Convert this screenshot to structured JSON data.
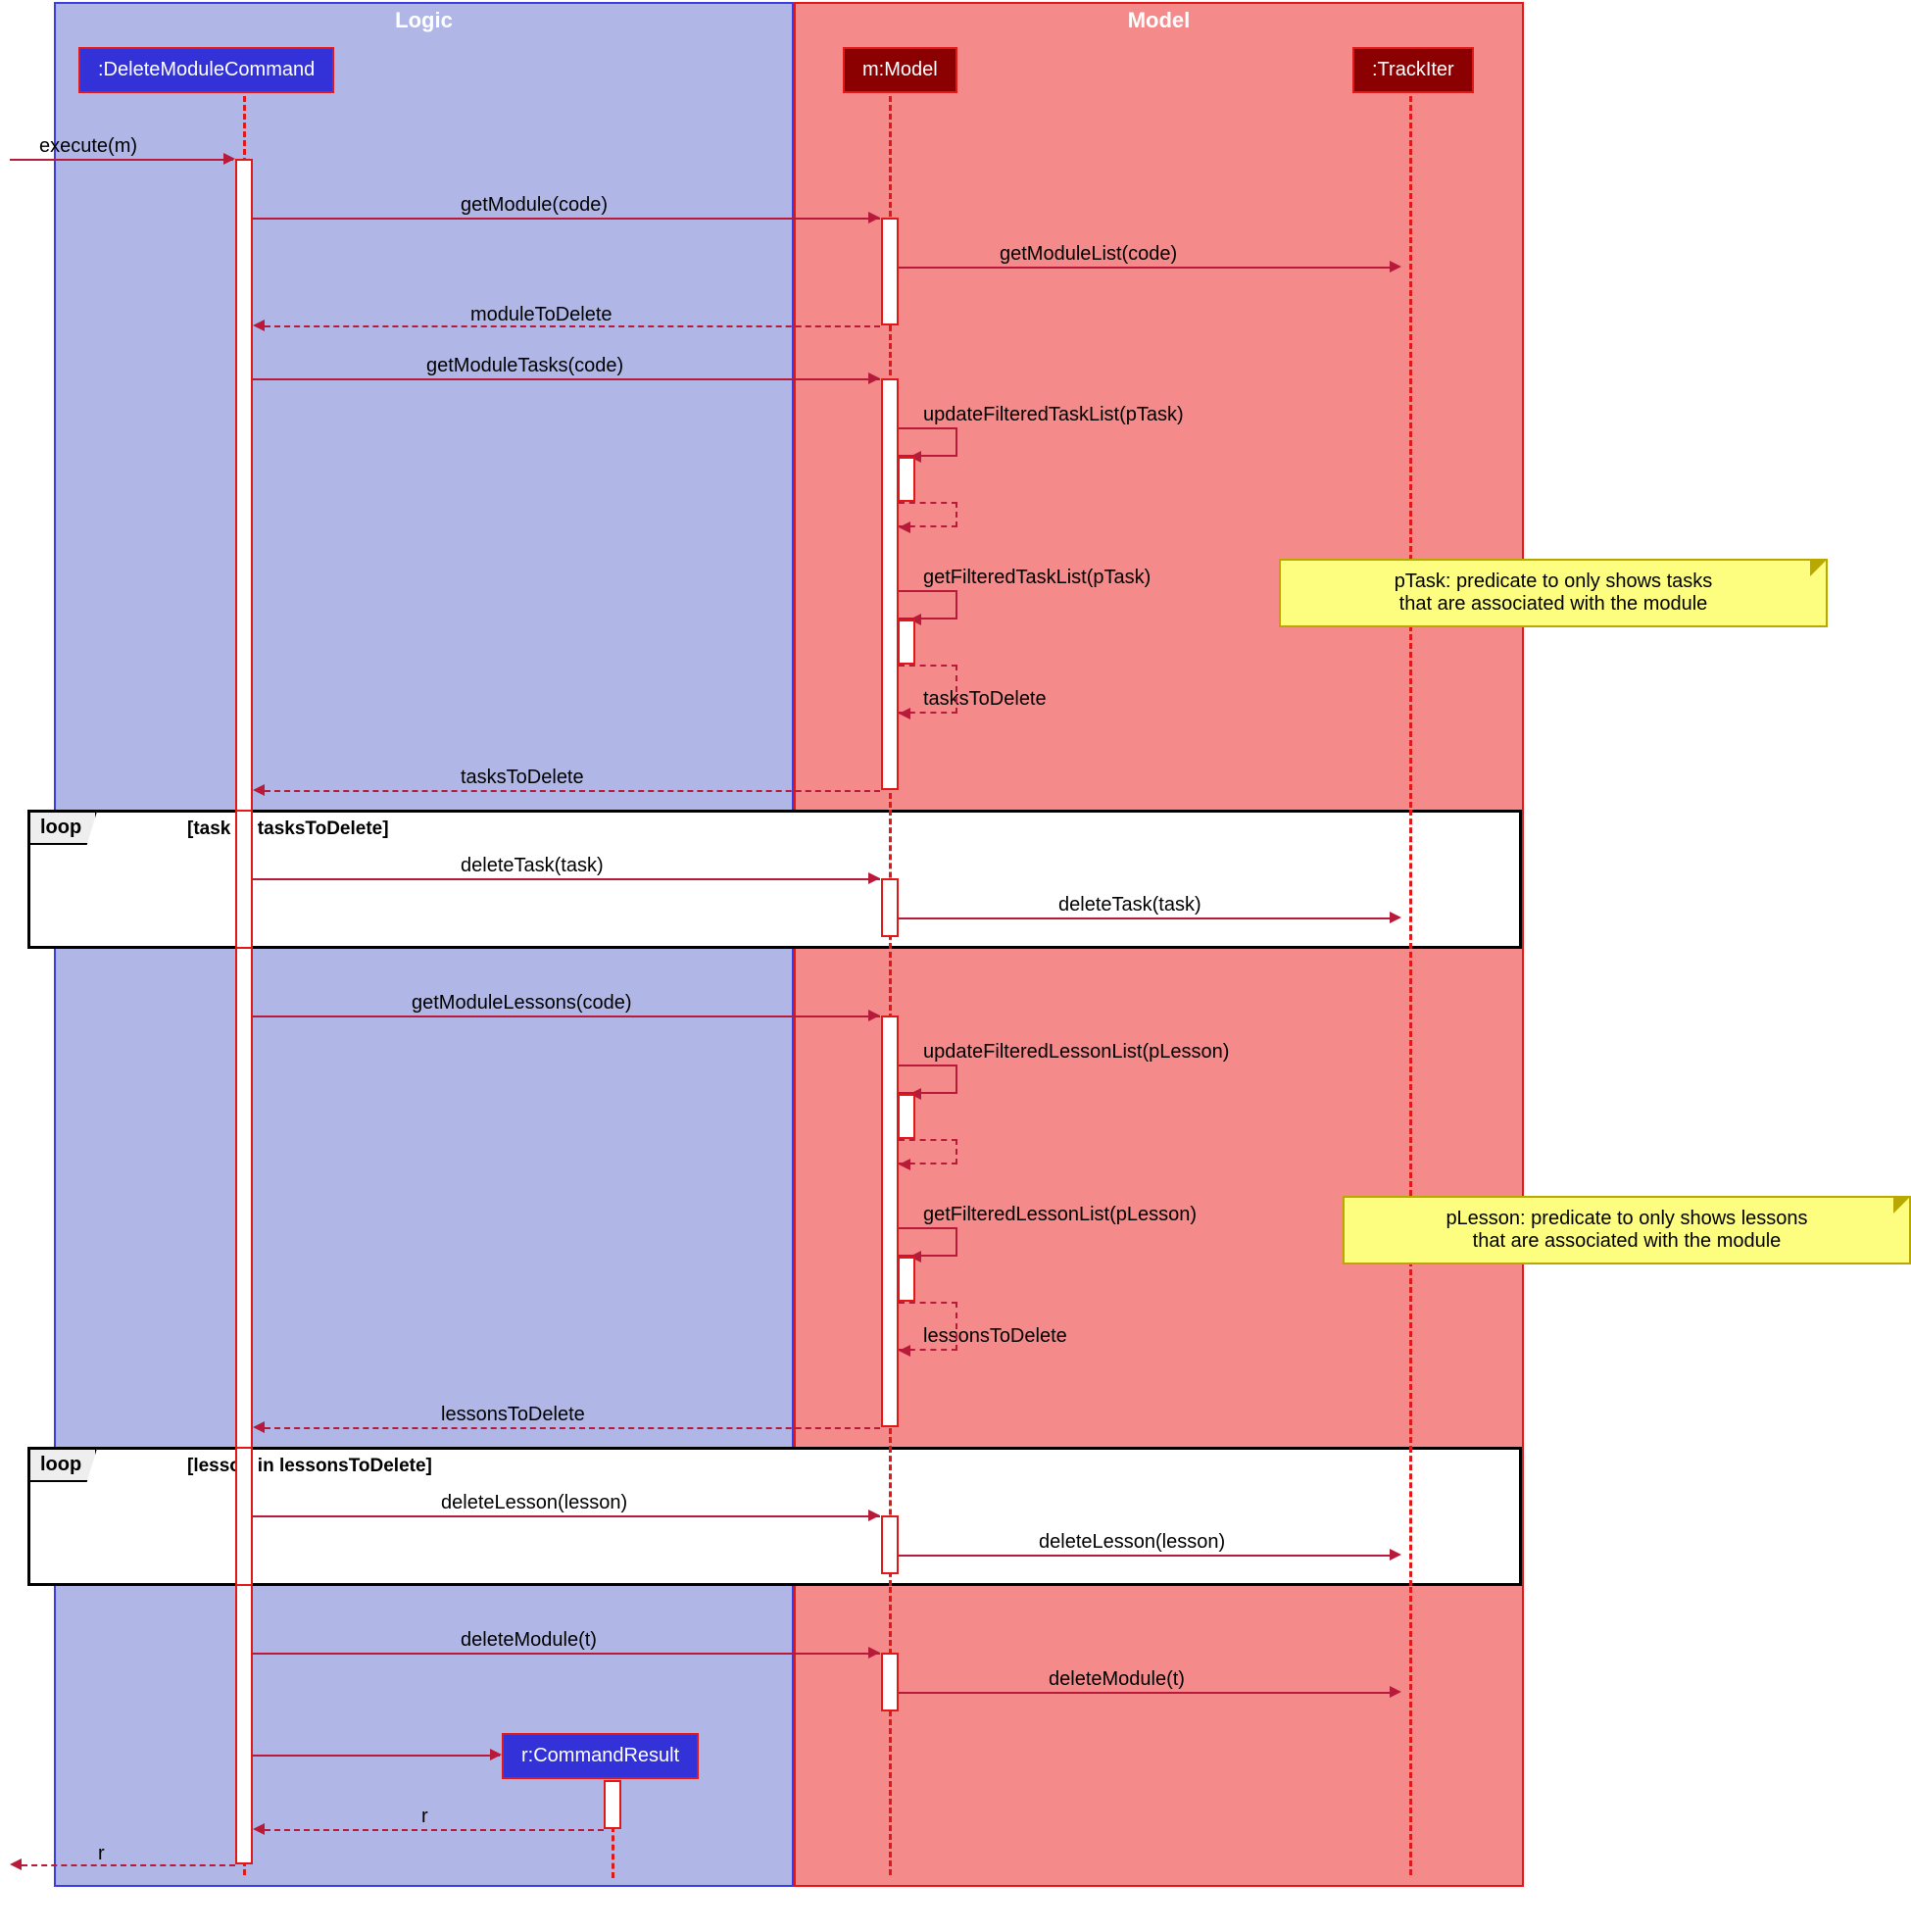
{
  "containers": {
    "logic": {
      "title": "Logic"
    },
    "model": {
      "title": "Model"
    }
  },
  "participants": {
    "cmd": {
      "label": ":DeleteModuleCommand"
    },
    "model": {
      "label": "m:Model"
    },
    "track": {
      "label": ":TrackIter"
    },
    "result": {
      "label": "r:CommandResult"
    }
  },
  "messages": {
    "execute": "execute(m)",
    "getModule": "getModule(code)",
    "getModuleList": "getModuleList(code)",
    "moduleToDelete": "moduleToDelete",
    "getModuleTasks": "getModuleTasks(code)",
    "updateFilteredTaskList": "updateFilteredTaskList(pTask)",
    "getFilteredTaskList": "getFilteredTaskList(pTask)",
    "tasksToDelete1": "tasksToDelete",
    "tasksToDelete2": "tasksToDelete",
    "deleteTask1": "deleteTask(task)",
    "deleteTask2": "deleteTask(task)",
    "getModuleLessons": "getModuleLessons(code)",
    "updateFilteredLessonList": "updateFilteredLessonList(pLesson)",
    "getFilteredLessonList": "getFilteredLessonList(pLesson)",
    "lessonsToDelete1": "lessonsToDelete",
    "lessonsToDelete2": "lessonsToDelete",
    "deleteLesson1": "deleteLesson(lesson)",
    "deleteLesson2": "deleteLesson(lesson)",
    "deleteModule1": "deleteModule(t)",
    "deleteModule2": "deleteModule(t)",
    "r1": "r",
    "r2": "r"
  },
  "fragments": {
    "loop1": {
      "label": "loop",
      "guard": "[task in tasksToDelete]"
    },
    "loop2": {
      "label": "loop",
      "guard": "[lesson in lessonsToDelete]"
    }
  },
  "notes": {
    "pTask": "pTask: predicate to only shows tasks\nthat are associated with the module",
    "pLesson": "pLesson: predicate to only shows lessons\nthat are associated with the module"
  },
  "chart_data": {
    "type": "uml-sequence-diagram",
    "containers": [
      {
        "name": "Logic",
        "participants": [
          "DeleteModuleCommand",
          "CommandResult"
        ]
      },
      {
        "name": "Model",
        "participants": [
          "Model",
          "TrackIter"
        ]
      }
    ],
    "participants": [
      {
        "id": "cmd",
        "name": ":DeleteModuleCommand",
        "container": "Logic"
      },
      {
        "id": "model",
        "name": "m:Model",
        "container": "Model"
      },
      {
        "id": "track",
        "name": ":TrackIter",
        "container": "Model"
      },
      {
        "id": "result",
        "name": "r:CommandResult",
        "container": "Logic",
        "created_during_sequence": true
      }
    ],
    "sequence": [
      {
        "type": "call",
        "from": "caller",
        "to": "cmd",
        "label": "execute(m)"
      },
      {
        "type": "call",
        "from": "cmd",
        "to": "model",
        "label": "getModule(code)"
      },
      {
        "type": "call",
        "from": "model",
        "to": "track",
        "label": "getModuleList(code)"
      },
      {
        "type": "return",
        "from": "model",
        "to": "cmd",
        "label": "moduleToDelete"
      },
      {
        "type": "call",
        "from": "cmd",
        "to": "model",
        "label": "getModuleTasks(code)"
      },
      {
        "type": "self",
        "on": "model",
        "label": "updateFilteredTaskList(pTask)",
        "note": "pTask: predicate to only shows tasks that are associated with the module"
      },
      {
        "type": "self",
        "on": "model",
        "label": "getFilteredTaskList(pTask)"
      },
      {
        "type": "self-return",
        "on": "model",
        "label": "tasksToDelete"
      },
      {
        "type": "return",
        "from": "model",
        "to": "cmd",
        "label": "tasksToDelete"
      },
      {
        "type": "loop",
        "guard": "[task in tasksToDelete]",
        "body": [
          {
            "type": "call",
            "from": "cmd",
            "to": "model",
            "label": "deleteTask(task)"
          },
          {
            "type": "call",
            "from": "model",
            "to": "track",
            "label": "deleteTask(task)"
          }
        ]
      },
      {
        "type": "call",
        "from": "cmd",
        "to": "model",
        "label": "getModuleLessons(code)"
      },
      {
        "type": "self",
        "on": "model",
        "label": "updateFilteredLessonList(pLesson)",
        "note": "pLesson: predicate to only shows lessons that are associated with the module"
      },
      {
        "type": "self",
        "on": "model",
        "label": "getFilteredLessonList(pLesson)"
      },
      {
        "type": "self-return",
        "on": "model",
        "label": "lessonsToDelete"
      },
      {
        "type": "return",
        "from": "model",
        "to": "cmd",
        "label": "lessonsToDelete"
      },
      {
        "type": "loop",
        "guard": "[lesson in lessonsToDelete]",
        "body": [
          {
            "type": "call",
            "from": "cmd",
            "to": "model",
            "label": "deleteLesson(lesson)"
          },
          {
            "type": "call",
            "from": "model",
            "to": "track",
            "label": "deleteLesson(lesson)"
          }
        ]
      },
      {
        "type": "call",
        "from": "cmd",
        "to": "model",
        "label": "deleteModule(t)"
      },
      {
        "type": "call",
        "from": "model",
        "to": "track",
        "label": "deleteModule(t)"
      },
      {
        "type": "create",
        "from": "cmd",
        "to": "result",
        "label": "r:CommandResult"
      },
      {
        "type": "return",
        "from": "result",
        "to": "cmd",
        "label": "r"
      },
      {
        "type": "return",
        "from": "cmd",
        "to": "caller",
        "label": "r"
      }
    ]
  }
}
